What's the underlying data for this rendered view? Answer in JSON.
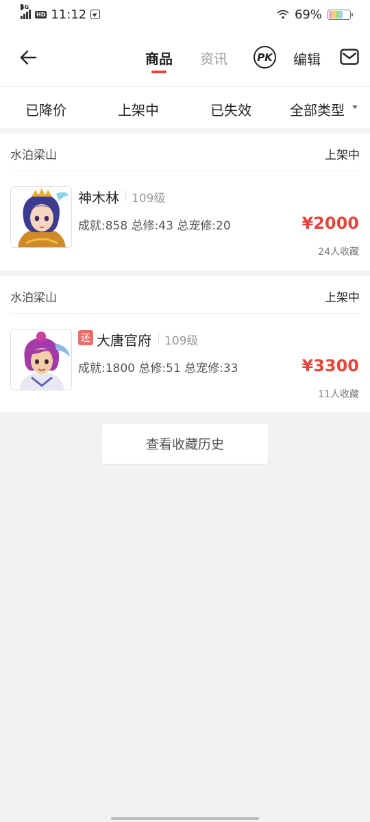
{
  "status_bar": {
    "network": "4G",
    "hd": "HD",
    "time": "11:12",
    "battery": "69%"
  },
  "nav": {
    "tabs": [
      {
        "label": "商品",
        "active": true
      },
      {
        "label": "资讯",
        "active": false
      }
    ],
    "pk_label": "PK",
    "edit_label": "编辑"
  },
  "filters": {
    "items": [
      "已降价",
      "上架中",
      "已失效",
      "全部类型"
    ]
  },
  "listings": [
    {
      "shop": "水泊梁山",
      "state": "上架中",
      "name": "神木林",
      "level": "109级",
      "stats": "成就:858  总修:43  总宠修:20",
      "price": "¥2000",
      "favorites": "24人收藏",
      "badge": ""
    },
    {
      "shop": "水泊梁山",
      "state": "上架中",
      "name": "大唐官府",
      "level": "109级",
      "stats": "成就:1800  总修:51  总宠修:33",
      "price": "¥3300",
      "favorites": "11人收藏",
      "badge": "还"
    }
  ],
  "history_button": "查看收藏历史",
  "colors": {
    "accent": "#e4463c",
    "badge": "#f06a6a"
  }
}
